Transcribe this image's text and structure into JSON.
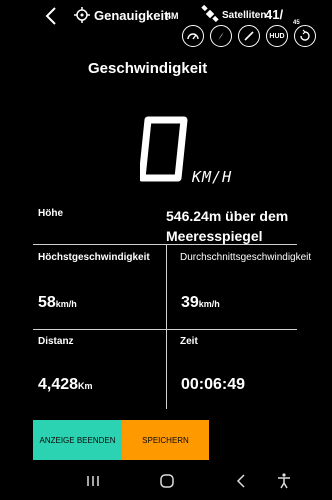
{
  "header": {
    "accuracy_label": "Genauigkeit",
    "accuracy_value": "4M",
    "satellites_label": "Satelliten",
    "satellites_value": "41/"
  },
  "tools": [
    {
      "icon": "speedometer-icon"
    },
    {
      "icon": "compass-icon"
    },
    {
      "icon": "pen-icon"
    },
    {
      "label": "HUD"
    },
    {
      "icon": "rotate-icon",
      "badge": "45"
    }
  ],
  "title": "Geschwindigkeit",
  "speed": {
    "value": "0",
    "unit": "KM/H"
  },
  "altitude": {
    "label": "Höhe",
    "value": "546.24m über dem Meeresspiegel"
  },
  "stats": {
    "max_speed": {
      "label": "Höchstgeschwindigkeit",
      "value": "58",
      "unit": "km/h"
    },
    "avg_speed": {
      "label": "Durchschnittsgeschwindigkeit",
      "value": "39",
      "unit": "km/h"
    },
    "distance": {
      "label": "Distanz",
      "value": "4,428",
      "unit": "Km"
    },
    "time": {
      "label": "Zeit",
      "value": "00:06:49"
    }
  },
  "buttons": {
    "end": "ANZEIGE BEENDEN",
    "save": "SPEICHERN"
  },
  "colors": {
    "end_button": "#2bd3b2",
    "save_button": "#ff9900",
    "background": "#000000"
  }
}
